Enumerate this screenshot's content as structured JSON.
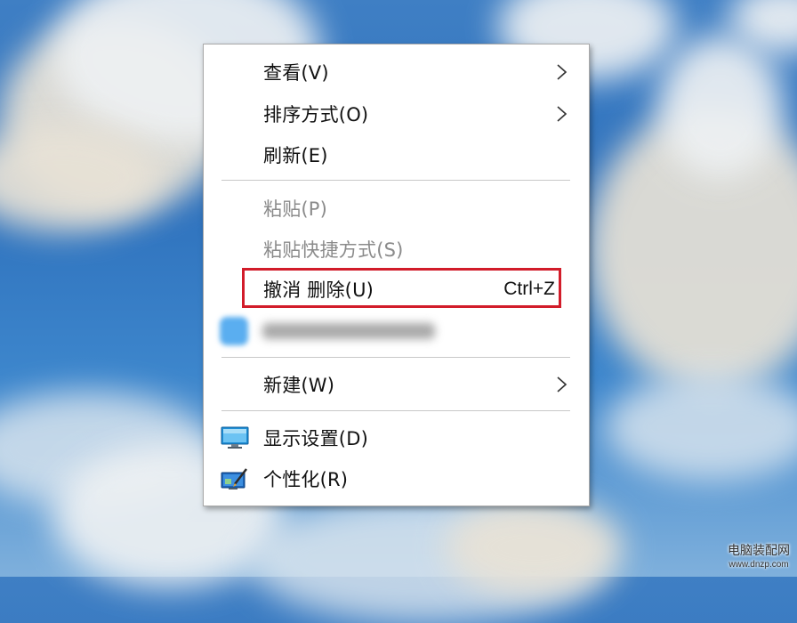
{
  "menu": {
    "items": [
      {
        "label": "查看(V)"
      },
      {
        "label": "排序方式(O)"
      },
      {
        "label": "刷新(E)"
      },
      {
        "label": "粘贴(P)"
      },
      {
        "label": "粘贴快捷方式(S)"
      },
      {
        "label": "撤消 删除(U)",
        "shortcut": "Ctrl+Z"
      },
      {
        "label": "新建(W)"
      },
      {
        "label": "显示设置(D)",
        "icon": "display-icon"
      },
      {
        "label": "个性化(R)",
        "icon": "personalize-icon"
      }
    ],
    "highlight_color": "#d21c2a"
  },
  "watermark": {
    "title": "电脑装配网",
    "url": "www.dnzp.com"
  }
}
